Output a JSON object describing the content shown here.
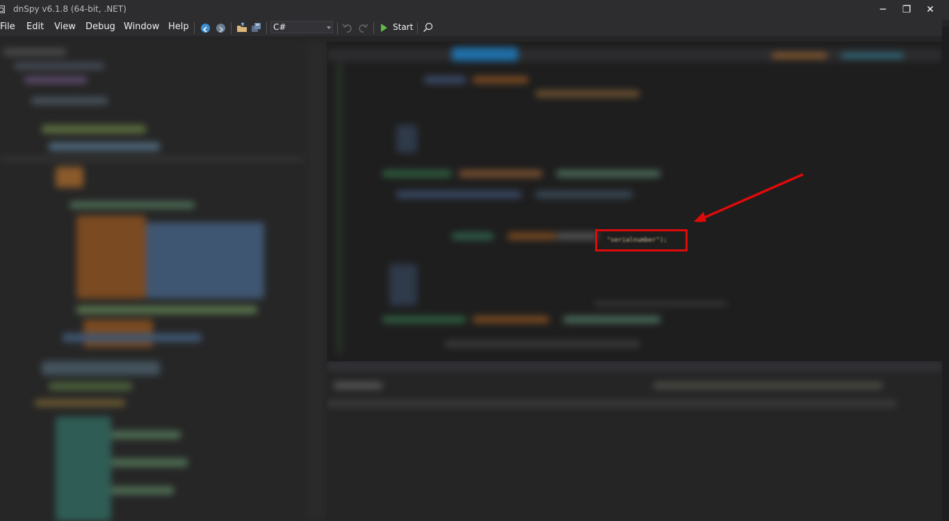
{
  "window": {
    "title": "dnSpy v6.1.8 (64-bit, .NET)",
    "controls": {
      "minimize": "─",
      "restore": "❐",
      "close": "✕"
    }
  },
  "menu": {
    "items": [
      "File",
      "Edit",
      "View",
      "Debug",
      "Window",
      "Help"
    ]
  },
  "toolbar": {
    "language": "C#",
    "start_label": "Start",
    "icons": [
      "back-icon",
      "forward-icon",
      "open-icon",
      "save-all-icon",
      "undo-icon",
      "redo-icon",
      "start-icon",
      "search-icon"
    ]
  },
  "annotation": {
    "highlighted_text": "\"serialnumber\");",
    "box_color": "#e00a0a",
    "arrow_color": "#e00a0a"
  },
  "colors": {
    "background": "#252526",
    "titlebar": "#2d2d30",
    "editor": "#1e1e1e"
  }
}
